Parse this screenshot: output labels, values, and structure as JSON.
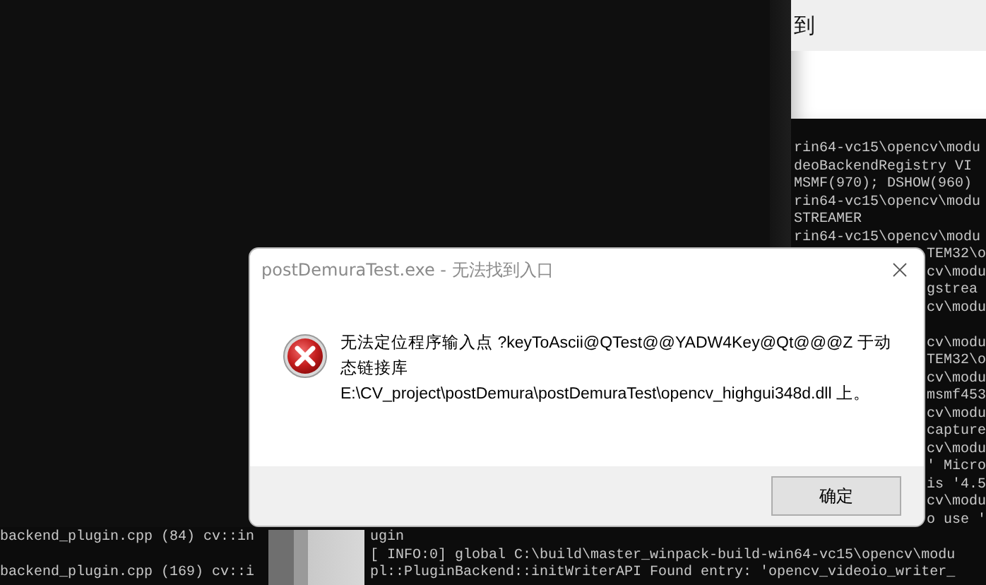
{
  "top_window": {
    "title": "到"
  },
  "left_console": {
    "lines": [
      "backend_plugin.cpp (84) cv::in",
      "backend_plugin.cpp (169) cv::i"
    ]
  },
  "console": {
    "lines": [
      {
        "kind": "right",
        "text": "rin64-vc15\\opencv\\modu"
      },
      {
        "kind": "right",
        "text": "deoBackendRegistry VI"
      },
      {
        "kind": "right",
        "text": "MSMF(970); DSHOW(960)"
      },
      {
        "kind": "right",
        "text": "rin64-vc15\\opencv\\modu"
      },
      {
        "kind": "right",
        "text": "STREAMER"
      },
      {
        "kind": "right",
        "text": "rin64-vc15\\opencv\\modu"
      },
      {
        "kind": "tail",
        "text": "TEM32\\o"
      },
      {
        "kind": "tail",
        "text": "cv\\modu"
      },
      {
        "kind": "tail",
        "text": "gstrea"
      },
      {
        "kind": "tail",
        "text": "cv\\modu"
      },
      {
        "kind": "tail-gap",
        "text": "cv\\modu"
      },
      {
        "kind": "tail",
        "text": "TEM32\\o"
      },
      {
        "kind": "tail",
        "text": "cv\\modu"
      },
      {
        "kind": "tail",
        "text": "msmf453"
      },
      {
        "kind": "tail",
        "text": "cv\\modu"
      },
      {
        "kind": "tail",
        "text": "capture"
      },
      {
        "kind": "tail",
        "text": "cv\\modu"
      },
      {
        "kind": "tail",
        "text": "' Micro"
      },
      {
        "kind": "tail",
        "text": "is '4.5"
      },
      {
        "kind": "tail",
        "text": "cv\\modu"
      },
      {
        "kind": "tail",
        "text": "o use '"
      },
      {
        "kind": "wide",
        "text": "ugin"
      },
      {
        "kind": "wide",
        "text": "[ INFO:0] global C:\\build\\master_winpack-build-win64-vc15\\opencv\\modu"
      },
      {
        "kind": "wide",
        "text": "pl::PluginBackend::initWriterAPI Found entry: 'opencv_videoio_writer_"
      }
    ]
  },
  "dialog": {
    "title": "postDemuraTest.exe - 无法找到入口",
    "message": "无法定位程序输入点 ?keyToAscii@QTest@@YADW4Key@Qt@@@Z 于动态链接库 E:\\CV_project\\postDemura\\postDemuraTest\\opencv_highgui348d.dll 上。",
    "buttons": [
      "确定"
    ]
  }
}
